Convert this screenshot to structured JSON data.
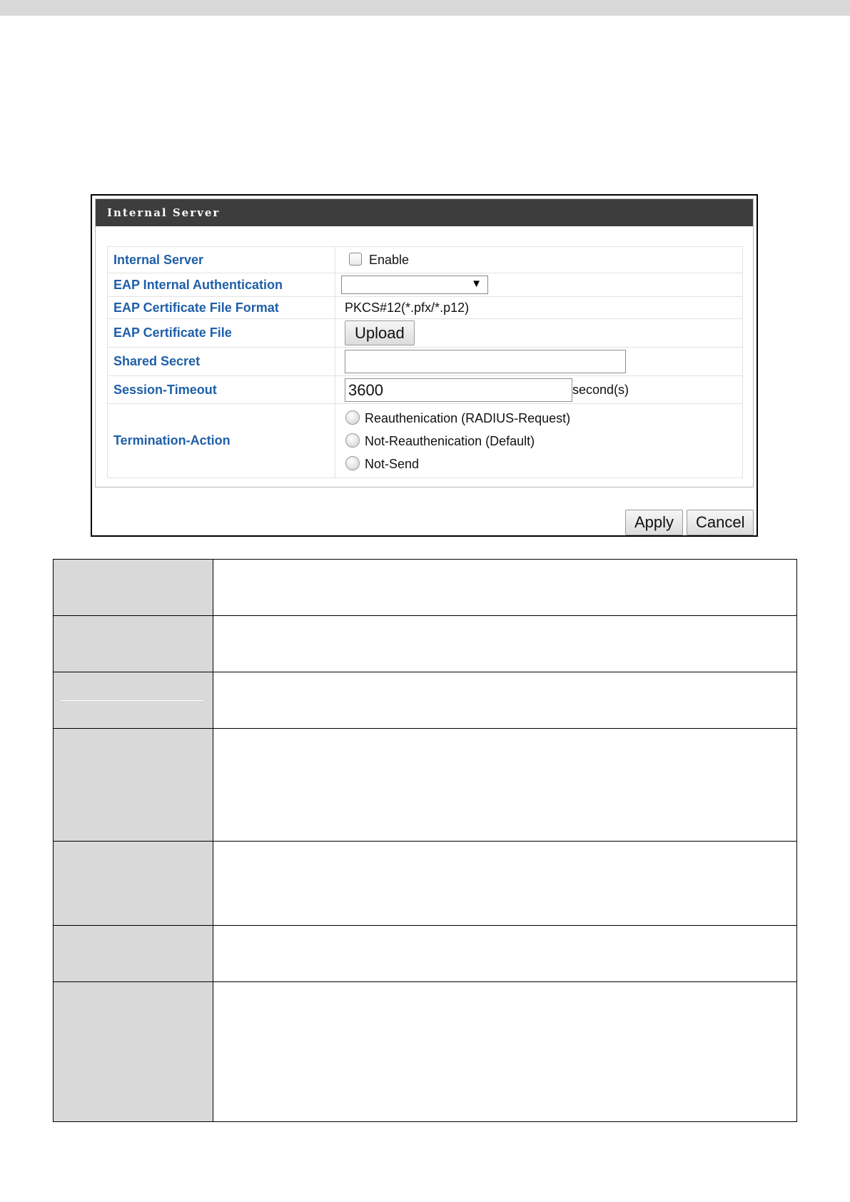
{
  "panel": {
    "title": "Internal Server"
  },
  "form": {
    "rows": [
      {
        "label": "Internal Server",
        "checkbox_label": "Enable"
      },
      {
        "label": "EAP Internal Authentication",
        "select_value": ""
      },
      {
        "label": "EAP Certificate File Format",
        "value": "PKCS#12(*.pfx/*.p12)"
      },
      {
        "label": "EAP Certificate File",
        "button_label": "Upload"
      },
      {
        "label": "Shared Secret",
        "input_value": ""
      },
      {
        "label": "Session-Timeout",
        "input_value": "3600",
        "unit": "second(s)"
      },
      {
        "label": "Termination-Action",
        "options": [
          "Reauthenication (RADIUS-Request)",
          "Not-Reauthenication (Default)",
          "Not-Send"
        ]
      }
    ]
  },
  "actions": {
    "apply_label": "Apply",
    "cancel_label": "Cancel"
  },
  "icons": {
    "dropdown": "chevron-down-icon"
  }
}
